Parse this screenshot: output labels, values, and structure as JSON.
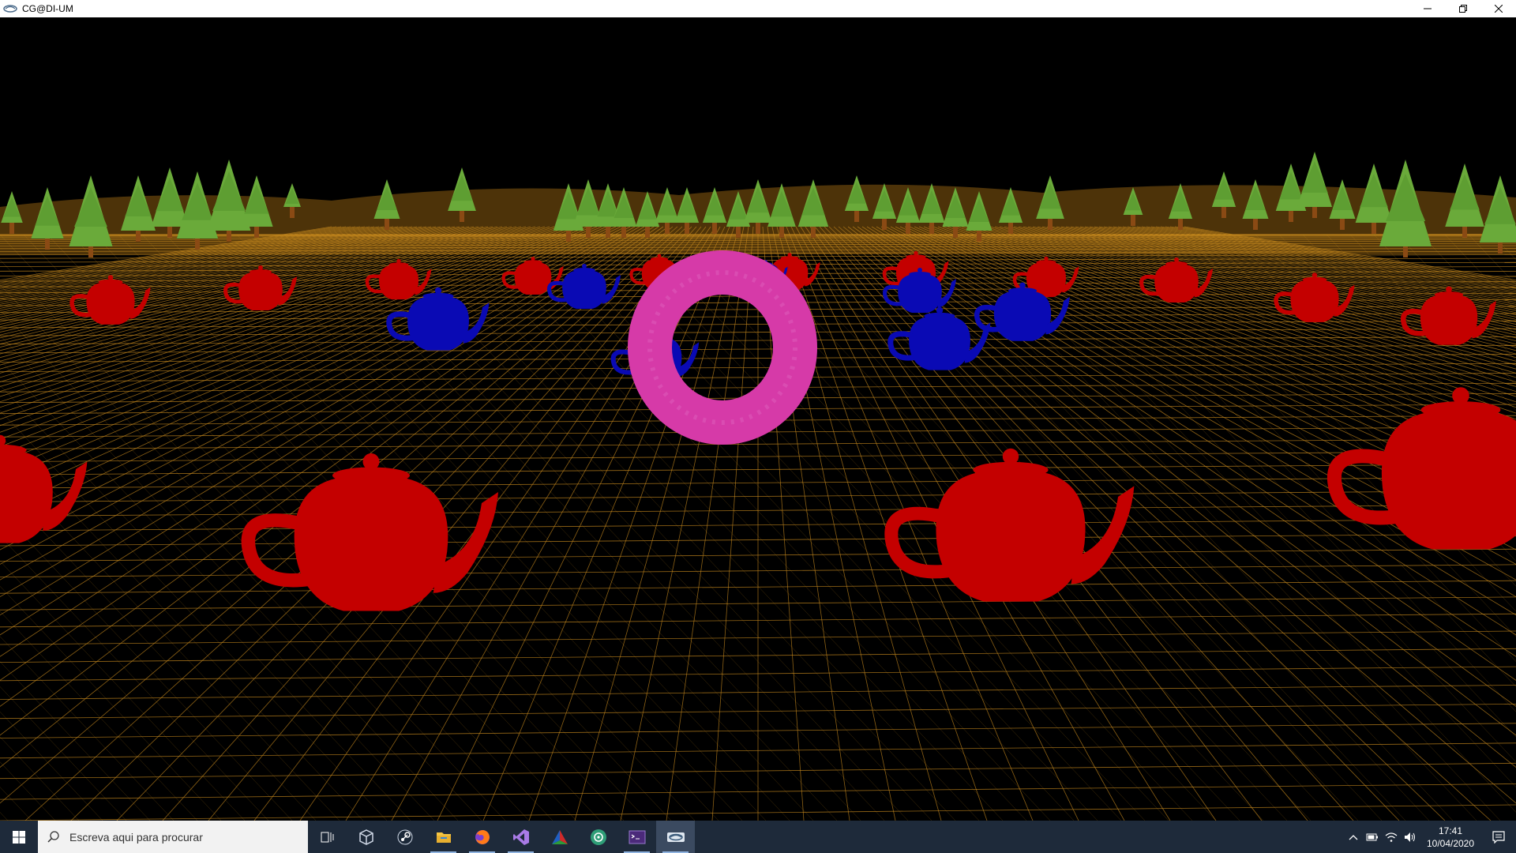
{
  "window": {
    "title": "CG@DI-UM",
    "controls": [
      "minimize-icon",
      "restore-icon",
      "close-icon"
    ]
  },
  "scene": {
    "background_color": "#000000",
    "terrain_wire_color": "#c88a1e",
    "tree_foliage_color": "#6aaa3a",
    "tree_trunk_color": "#8a4a14",
    "red_teapot_color": "#c40000",
    "blue_teapot_color": "#0a0ab4",
    "torus_color": "#d63aa8"
  },
  "taskbar": {
    "search_placeholder": "Escreva aqui para procurar",
    "apps": [
      {
        "icon": "task-view-icon"
      },
      {
        "icon": "virtualbox-icon"
      },
      {
        "icon": "steam-icon"
      },
      {
        "icon": "file-explorer-icon"
      },
      {
        "icon": "firefox-icon"
      },
      {
        "icon": "visual-studio-icon"
      },
      {
        "icon": "cmake-icon"
      },
      {
        "icon": "chatgpt-icon"
      },
      {
        "icon": "terminal-icon"
      },
      {
        "icon": "glut-app-icon"
      }
    ],
    "clock_time": "17:41",
    "clock_date": "10/04/2020"
  }
}
